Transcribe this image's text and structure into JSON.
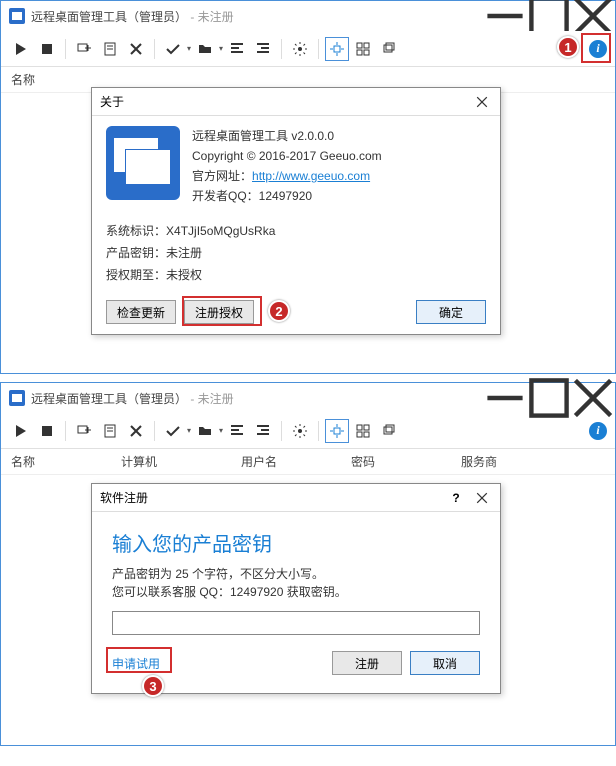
{
  "win1": {
    "title": "远程桌面管理工具（管理员）",
    "status": " - 未注册",
    "cols": {
      "name": "名称"
    }
  },
  "about": {
    "title": "关于",
    "product": "远程桌面管理工具  v2.0.0.0",
    "copyright": "Copyright © 2016-2017 Geeuo.com",
    "website_label": "官方网址：",
    "website_url": "http://www.geeuo.com",
    "devqq": "开发者QQ：12497920",
    "sysid_label": "系统标识：",
    "sysid": "X4TJjI5oMQgUsRka",
    "key_label": "产品密钥：",
    "key_val": "未注册",
    "license_label": "授权期至：",
    "license_val": "未授权",
    "btn_update": "检查更新",
    "btn_register": "注册授权",
    "btn_ok": "确定"
  },
  "win2": {
    "title": "远程桌面管理工具（管理员）",
    "status": " - 未注册",
    "cols": {
      "name": "名称",
      "computer": "计算机",
      "user": "用户名",
      "pass": "密码",
      "provider": "服务商"
    }
  },
  "reg": {
    "title": "软件注册",
    "heading": "输入您的产品密钥",
    "line1": "产品密钥为 25 个字符，不区分大小写。",
    "line2": "您可以联系客服 QQ：12497920 获取密钥。",
    "trial": "申请试用",
    "btn_register": "注册",
    "btn_cancel": "取消"
  }
}
